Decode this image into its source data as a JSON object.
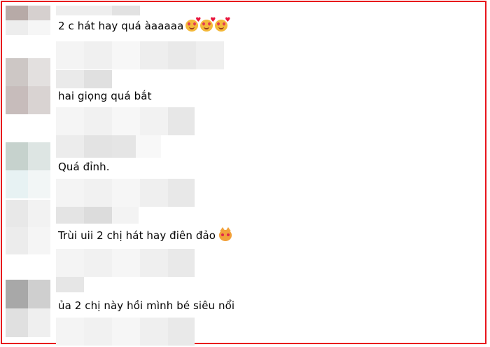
{
  "comments": [
    {
      "text": "2 c hát hay quá àaaaaa",
      "emoji": [
        "smiling-face-with-hearts-icon",
        "smiling-face-with-hearts-icon",
        "smiling-face-with-hearts-icon"
      ]
    },
    {
      "text": "hai giọng quá bắt"
    },
    {
      "text": "Quá đỉnh."
    },
    {
      "text": "Trùi uii 2 chị hát hay điên đảo",
      "emoji": [
        "heart-eyes-cat-icon"
      ]
    },
    {
      "text": "ủa 2 chị này hồi mình bé siêu nổi"
    }
  ],
  "colors": {
    "border": "#e8141c",
    "text": "#050505",
    "blur_light": "#f2f2f2",
    "blur_mid": "#e6e6e6"
  }
}
